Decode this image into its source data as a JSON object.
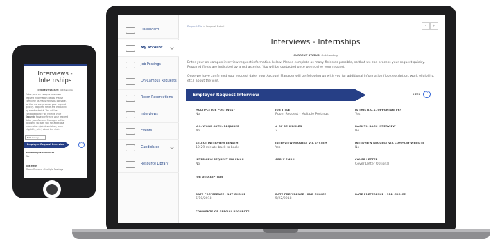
{
  "breadcrumb": {
    "link": "Request File",
    "separator": " > ",
    "current": "Request Detail"
  },
  "nav": {
    "prev": "‹",
    "next": "›"
  },
  "sidebar": {
    "items": [
      {
        "label": "Dashboard",
        "icon": "dashboard-icon"
      },
      {
        "label": "My Account",
        "icon": "account-icon"
      },
      {
        "label": "Job Postings",
        "icon": "briefcase-icon"
      },
      {
        "label": "On-Campus Requests",
        "icon": "clipboard-icon"
      },
      {
        "label": "Room Reservations",
        "icon": "room-icon"
      },
      {
        "label": "Interviews",
        "icon": "chat-icon"
      },
      {
        "label": "Events",
        "icon": "events-icon"
      },
      {
        "label": "Candidates",
        "icon": "binoculars-icon"
      },
      {
        "label": "Resource Library",
        "icon": "library-icon"
      }
    ]
  },
  "page": {
    "title": "Interviews - Internships",
    "status_label": "CURRENT STATUS:",
    "status_value": "Outstanding",
    "intro1": "Enter your on-campus interview request information below. Please complete as many fields as possible, so that we can process your request quickly. Required fields are indicated by a red asterisk. You will be contacted once we receive your request.",
    "intro2": "Once we have confirmed your request date, your Account Manager will be following up with you for additional information (job description, work eligibility, etc.) about the visit."
  },
  "section": {
    "title": "Employer Request Interview",
    "less_label": "LESS",
    "less_icon": "chevron-up-icon"
  },
  "fields": {
    "multiple_postings": {
      "label": "MULTIPLE JOB POSTINGS?",
      "value": "No"
    },
    "job_title": {
      "label": "JOB TITLE",
      "value": "Room Request - Multiple Postings"
    },
    "us_opportunity": {
      "label": "IS THIS A U.S. OPPORTUNITY?",
      "value": "Yes"
    },
    "work_auth": {
      "label": "U.S. WORK AUTH. REQUIRED",
      "value": "No"
    },
    "num_schedules": {
      "label": "# OF SCHEDULES",
      "value": "2"
    },
    "back_to_back": {
      "label": "BACK-TO-BACK INTERVIEW",
      "value": "No"
    },
    "interview_length": {
      "label": "SELECT INTERVIEW LENGTH",
      "value": "10-29 minute back to back"
    },
    "via_system": {
      "label": "INTERVIEW REQUEST VIA SYSTEM",
      "value": "Yes"
    },
    "via_website": {
      "label": "INTERVIEW REQUEST VIA COMPANY WEBSITE",
      "value": "No"
    },
    "via_email": {
      "label": "INTERVIEW REQUEST VIA EMAIL",
      "value": "No"
    },
    "apply_email": {
      "label": "APPLY EMAIL",
      "value": ""
    },
    "cover_letter": {
      "label": "COVER LETTER",
      "value": "Cover Letter Optional"
    },
    "job_description": {
      "label": "JOB DESCRIPTION",
      "value": ""
    },
    "date1": {
      "label": "DATE PREFERENCE - 1ST CHOICE",
      "value": "5/10/2018"
    },
    "date2": {
      "label": "DATE PREFERENCE - 2ND CHOICE",
      "value": "5/22/2018"
    },
    "date3": {
      "label": "DATE PREFERENCE - 3RD CHOICE",
      "value": ""
    },
    "comments": {
      "label": "COMMENTS OR SPECIAL REQUESTS",
      "value": ""
    }
  },
  "phone": {
    "title_line1": "Interviews -",
    "title_line2": "Internships",
    "status_label": "CURRENT STATUS:",
    "status_value": "Outstanding",
    "intro1": "Enter your on-campus interview request information below. Please complete as many fields as possible, so that we can process your request quickly. Required fields are indicated by a red asterisk. You will be contacted once we receive your request.",
    "intro2": "Once we have confirmed your request date, your Account Manager will be following up with you for additional information (job description, work eligibility, etc.) about the visit.",
    "edit_label": "Edit survey",
    "section_title": "Employer Request Interview",
    "less_icon": "chevron-up-icon",
    "field1_label": "MULTIPLE JOB POSTINGS?",
    "field1_value": "No",
    "field2_label": "JOB TITLE",
    "field2_value": "Room Request - Multiple Postings"
  },
  "colors": {
    "brand_navy": "#263f86",
    "link_blue": "#3a6ad8",
    "device_black": "#1d1d1f"
  }
}
